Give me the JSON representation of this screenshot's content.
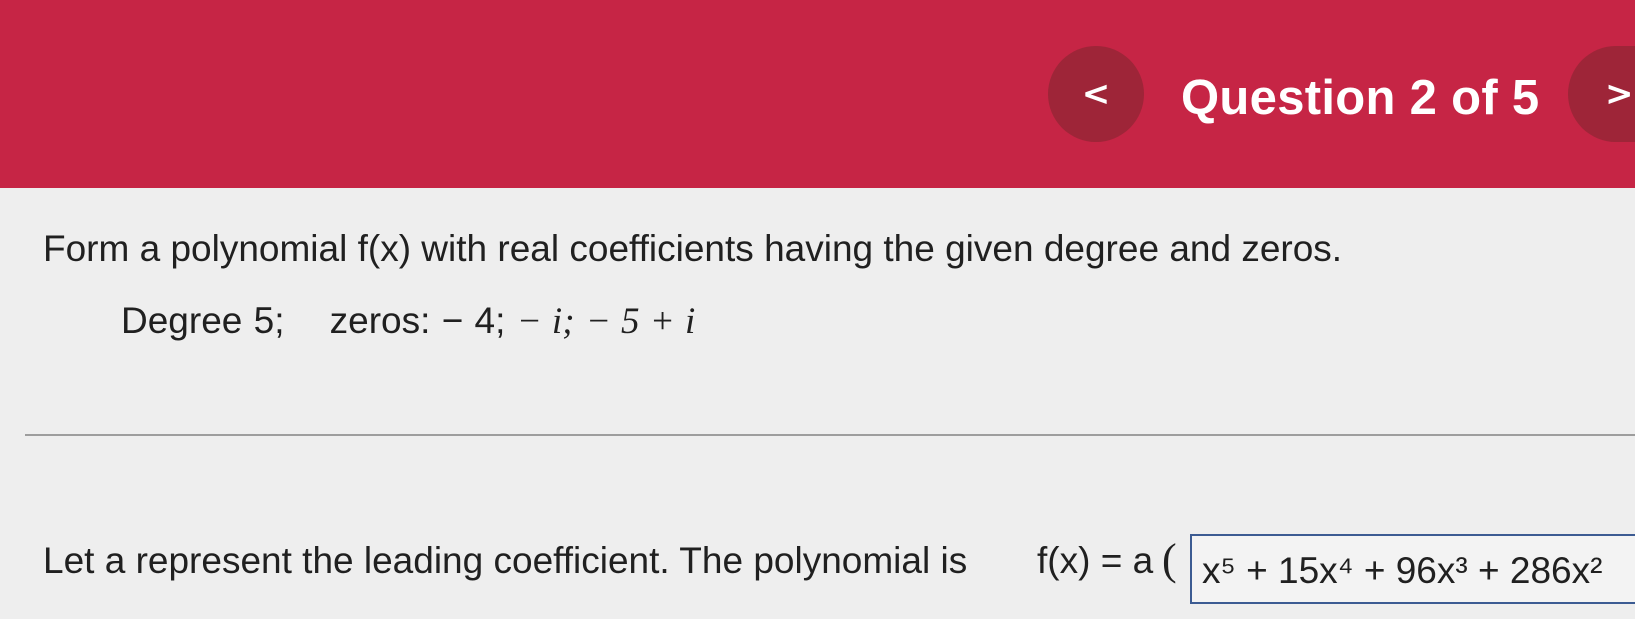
{
  "header": {
    "previous_symbol": "<",
    "title": "Question 2 of 5",
    "next_symbol": ">"
  },
  "question": {
    "instruction": "Form a polynomial f(x) with real coefficients having the given degree and zeros.",
    "degree": "Degree 5;",
    "zeros_label": "zeros:",
    "zero_1": "− 4;",
    "zero_2": "− i;",
    "zero_3": "− 5 + i"
  },
  "answer": {
    "prompt": "Let a represent the leading coefficient. The polynomial is",
    "function": "f(x) = a",
    "open_paren": "(",
    "polynomial_value": "x⁵ + 15x⁴ + 96x³ + 286x²"
  },
  "colors": {
    "header": "#c62545",
    "nav_button": "#9e2538",
    "answer_border": "#3c5b92"
  }
}
